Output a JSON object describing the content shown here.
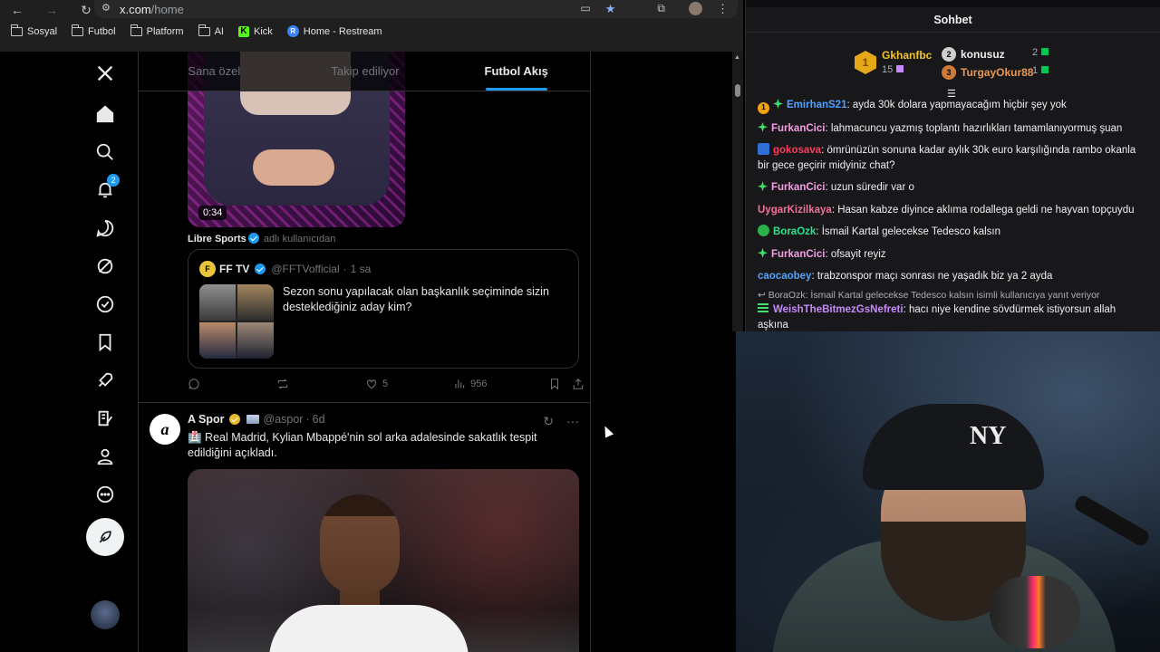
{
  "browser": {
    "url_domain": "x.com",
    "url_path": "/home",
    "bookmarks": [
      {
        "label": "Sosyal",
        "icon": "folder-icon"
      },
      {
        "label": "Futbol",
        "icon": "folder-icon"
      },
      {
        "label": "Platform",
        "icon": "folder-icon"
      },
      {
        "label": "AI",
        "icon": "folder-icon"
      },
      {
        "label": "Kick",
        "icon": "kick-icon"
      },
      {
        "label": "Home - Restream",
        "icon": "restream-icon"
      }
    ]
  },
  "x": {
    "notification_count": "2",
    "tabs": [
      {
        "label": "Sana özel",
        "active": false
      },
      {
        "label": "Takip ediliyor",
        "active": false
      },
      {
        "label": "Futbol Akış",
        "active": true
      }
    ],
    "post1": {
      "video_duration": "0:34",
      "source_account": "Libre Sports",
      "source_suffix": "adlı kullanıcıdan",
      "quote": {
        "avatar_text": "F",
        "name": "FF TV",
        "handle": "@FFTVofficial",
        "time": "1 sa",
        "text": "Sezon sonu yapılacak olan başkanlık seçiminde sizin desteklediğiniz aday kim?"
      },
      "likes": "5",
      "views": "956"
    },
    "post2": {
      "avatar_text": "a",
      "name": "A Spor",
      "handle": "@aspor",
      "time": "6d",
      "text": "🏥 Real Madrid, Kylian Mbappé'nin sol arka adalesinde sakatlık tespit edildiğini açıkladı."
    }
  },
  "chat": {
    "title": "Sohbet",
    "top_gifters": [
      {
        "rank": "1",
        "name": "Gkhanfbc",
        "count": "15"
      },
      {
        "rank": "2",
        "name": "konusuz",
        "count": "2"
      },
      {
        "rank": "3",
        "name": "TurgayOkur88",
        "count": "1"
      }
    ],
    "messages": [
      {
        "user": "EmirhanS21",
        "color": "#4ea3ff",
        "badges": [
          "medal",
          "spark"
        ],
        "text": "ayda 30k dolara yapmayacağım hiçbir şey yok"
      },
      {
        "user": "FurkanCici",
        "color": "#f59ee5",
        "badges": [
          "spark"
        ],
        "text": "lahmacuncu yazmış toplantı hazırlıkları tamamlanıyormuş şuan"
      },
      {
        "user": "gokosava",
        "color": "#ff3b5c",
        "badges": [
          "blue"
        ],
        "text": "ömrünüzün sonuna kadar aylık 30k euro karşılığında rambo okanla bir gece geçirir midyiniz chat?"
      },
      {
        "user": "FurkanCici",
        "color": "#f59ee5",
        "badges": [
          "spark"
        ],
        "text": "uzun süredir var o"
      },
      {
        "user": "UygarKizilkaya",
        "color": "#f0719b",
        "badges": [],
        "text": "Hasan kabze diyince aklıma rodallega geldi ne hayvan topçuydu"
      },
      {
        "user": "BoraOzk",
        "color": "#2ee08c",
        "badges": [
          "green"
        ],
        "text": "İsmail Kartal gelecekse Tedesco kalsın"
      },
      {
        "user": "FurkanCici",
        "color": "#f59ee5",
        "badges": [
          "spark"
        ],
        "text": "ofsayit reyiz"
      },
      {
        "user": "caocaobey",
        "color": "#4ea3ff",
        "badges": [],
        "text": "trabzonspor maçı sonrası ne yaşadık biz ya 2 ayda"
      },
      {
        "user": "WeishTheBitmezGsNefreti",
        "color": "#c58af9",
        "badges": [
          "bars"
        ],
        "reply": "BoraOzk: İsmail Kartal gelecekse Tedesco kalsın isimli kullanıcıya yanıt veriyor",
        "text": "hacı niye kendine sövdürmek istiyorsun allah aşkına"
      }
    ]
  },
  "webcam": {
    "cap_logo": "NY"
  }
}
